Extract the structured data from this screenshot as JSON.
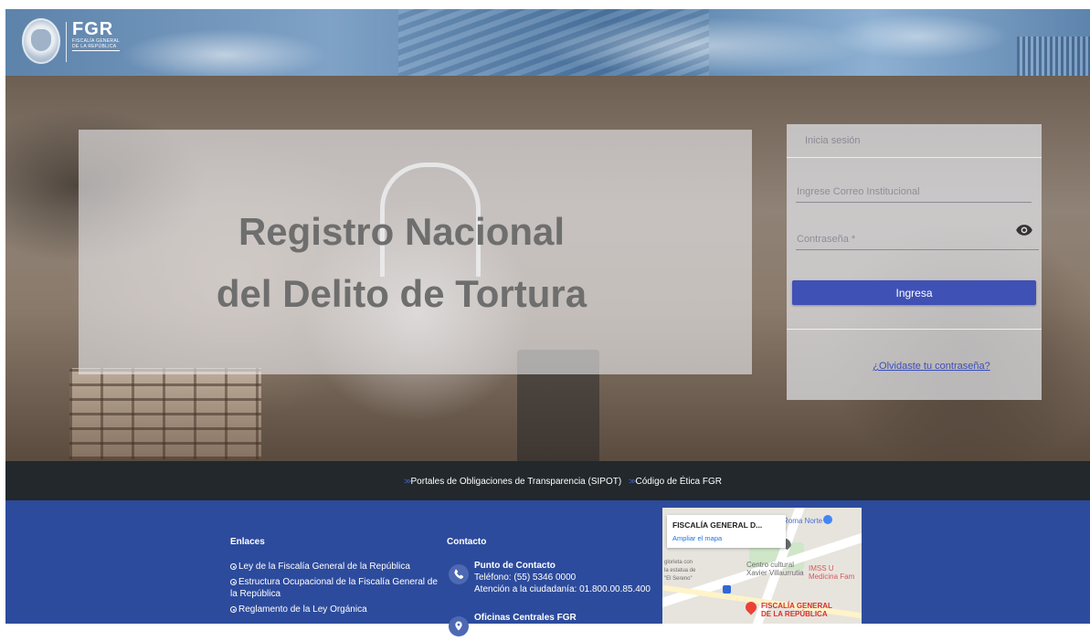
{
  "header": {
    "logo_text": "FGR",
    "logo_sub_1": "FISCALÍA GENERAL",
    "logo_sub_2": "DE LA REPÚBLICA"
  },
  "hero": {
    "title_line1": "Registro Nacional",
    "title_line2": "del Delito de Tortura"
  },
  "login": {
    "header": "Inicia sesión",
    "email_placeholder": "Ingrese Correo Institucional",
    "password_placeholder": "Contraseña *",
    "submit_label": "Ingresa",
    "forgot_label": "¿Olvidaste tu contraseña?"
  },
  "linkbar": {
    "links": [
      {
        "chev": ">>",
        "label": "Portales de Obligaciones de Transparencia (SIPOT)"
      },
      {
        "chev": ">>",
        "label": "Código de Ética FGR"
      }
    ]
  },
  "footer": {
    "enlaces_title": "Enlaces",
    "enlaces": [
      "Ley de la Fiscalía General de la República",
      "Estructura Ocupacional de la Fiscalía General de la República",
      "Reglamento de la Ley Orgánica"
    ],
    "contacto_title": "Contacto",
    "contact_point_title": "Punto de Contacto",
    "contact_phone": "Teléfono: (55) 5346 0000",
    "contact_citizen": "Atención a la ciudadanía: 01.800.00.85.400",
    "offices_title": "Oficinas Centrales FGR"
  },
  "map": {
    "popup_title": "FISCALÍA GENERAL D...",
    "popup_link": "Ampliar el mapa",
    "label_roma": "Roma Norte",
    "label_cc_1": "Centro cultural",
    "label_cc_2": "Xavier Villaurrutia",
    "label_imss_1": "IMSS U",
    "label_imss_2": "Medicina Fam",
    "label_glorieta_1": "glorieta con",
    "label_glorieta_2": "la estatua de",
    "label_glorieta_3": "\"El Sereno\"",
    "pin_label_1": "FISCALÍA GENERAL",
    "pin_label_2": "DE LA REPÚBLICA"
  },
  "colors": {
    "primary_button": "#3f51b5",
    "footer_bg": "#2d4b9c",
    "linkbar_bg": "#22282b",
    "link_color": "#3a4fb8"
  },
  "icons": {
    "password_toggle": "eye-icon",
    "phone": "phone-icon",
    "location": "location-icon"
  }
}
